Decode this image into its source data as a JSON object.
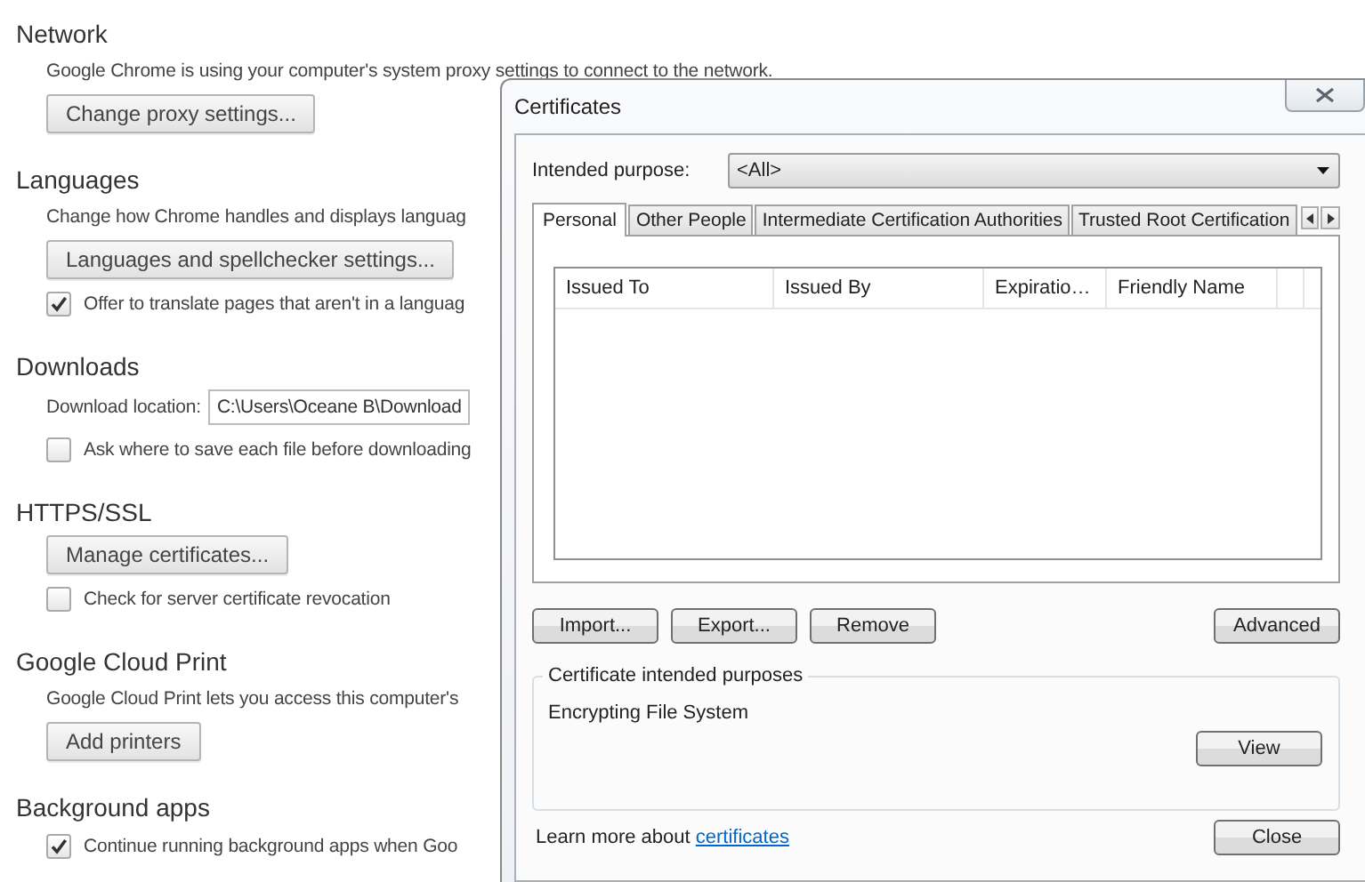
{
  "settings": {
    "sections": [
      {
        "title": "Network",
        "items": [
          {
            "kind": "text",
            "text": "Google Chrome is using your computer's system proxy settings to connect to the network."
          },
          {
            "kind": "button",
            "label": "Change proxy settings..."
          }
        ]
      },
      {
        "title": "Languages",
        "items": [
          {
            "kind": "text",
            "text": "Change how Chrome handles and displays languag"
          },
          {
            "kind": "button",
            "label": "Languages and spellchecker settings..."
          },
          {
            "kind": "checkbox",
            "label": "Offer to translate pages that aren't in a languag",
            "checked": true
          }
        ]
      },
      {
        "title": "Downloads",
        "items": [
          {
            "kind": "field",
            "label": "Download location:",
            "value": "C:\\Users\\Oceane B\\Download"
          },
          {
            "kind": "checkbox",
            "label": "Ask where to save each file before downloading",
            "checked": false
          }
        ]
      },
      {
        "title": "HTTPS/SSL",
        "items": [
          {
            "kind": "button",
            "label": "Manage certificates..."
          },
          {
            "kind": "checkbox",
            "label": "Check for server certificate revocation",
            "checked": false
          }
        ]
      },
      {
        "title": "Google Cloud Print",
        "items": [
          {
            "kind": "text",
            "text": "Google Cloud Print lets you access this computer's"
          },
          {
            "kind": "button",
            "label": "Add printers"
          }
        ]
      },
      {
        "title": "Background apps",
        "items": [
          {
            "kind": "checkbox",
            "label": "Continue running background apps when Goo",
            "checked": true
          }
        ]
      }
    ]
  },
  "dialog": {
    "title": "Certificates",
    "purpose_label": "Intended purpose:",
    "purpose_value": "<All>",
    "tabs": [
      {
        "label": "Personal",
        "selected": true
      },
      {
        "label": "Other People",
        "selected": false
      },
      {
        "label": "Intermediate Certification Authorities",
        "selected": false
      },
      {
        "label": "Trusted Root Certification",
        "selected": false
      }
    ],
    "columns": [
      "Issued To",
      "Issued By",
      "Expiratio…",
      "Friendly Name"
    ],
    "actions": [
      "Import...",
      "Export...",
      "Remove"
    ],
    "advanced_button": "Advanced",
    "group_title": "Certificate intended purposes",
    "group_text": "Encrypting File System",
    "view_button": "View",
    "footer_text": "Learn more about",
    "footer_link": "certificates",
    "close_button": "Close"
  }
}
